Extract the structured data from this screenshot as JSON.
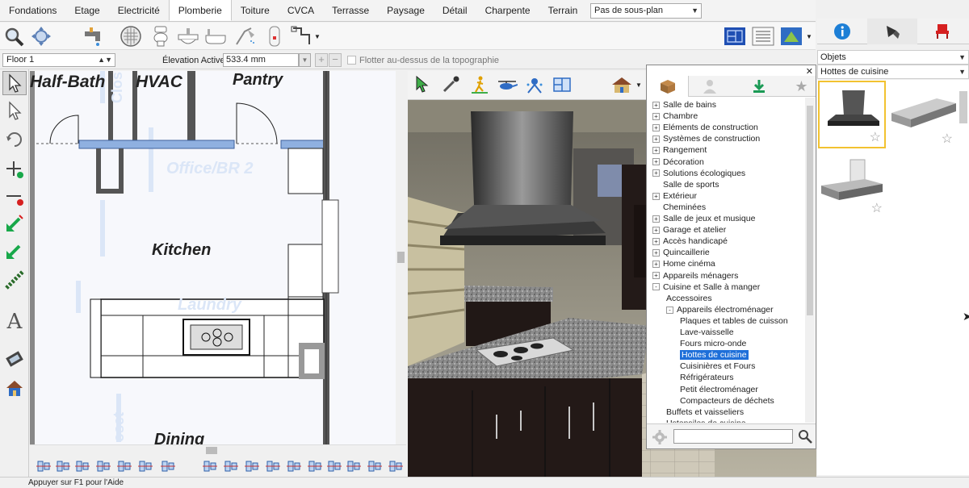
{
  "tabs": [
    "Fondations",
    "Etage",
    "Electricité",
    "Plomberie",
    "Toiture",
    "CVCA",
    "Terrasse",
    "Paysage",
    "Détail",
    "Charpente",
    "Terrain"
  ],
  "active_tab": "Plomberie",
  "plan_selector": {
    "value": "Pas de sous-plan"
  },
  "row2": {
    "floor": "Floor 1",
    "elevation_label": "Élevation Active:",
    "elevation_value": "533.4 mm",
    "float_label": "Flotter au-dessus de la topographie"
  },
  "plan": {
    "rooms": [
      "Half-Bath",
      "HVAC",
      "Pantry",
      "Kitchen",
      "Office/BR 2",
      "Laundry",
      "Dining"
    ],
    "faint_closet_top": "Clos",
    "faint_closet_bottom": "oset"
  },
  "library": {
    "tree": [
      {
        "label": "Salle de bains",
        "level": 0,
        "expander": "+"
      },
      {
        "label": "Chambre",
        "level": 0,
        "expander": "+"
      },
      {
        "label": "Eléments de construction",
        "level": 0,
        "expander": "+"
      },
      {
        "label": "Systèmes de construction",
        "level": 0,
        "expander": "+"
      },
      {
        "label": "Rangement",
        "level": 0,
        "expander": "+"
      },
      {
        "label": "Décoration",
        "level": 0,
        "expander": "+"
      },
      {
        "label": "Solutions écologiques",
        "level": 0,
        "expander": "+"
      },
      {
        "label": "Salle de sports",
        "level": 0,
        "expander": ""
      },
      {
        "label": "Extérieur",
        "level": 0,
        "expander": "+"
      },
      {
        "label": "Cheminées",
        "level": 0,
        "expander": ""
      },
      {
        "label": "Salle de jeux et musique",
        "level": 0,
        "expander": "+"
      },
      {
        "label": "Garage et atelier",
        "level": 0,
        "expander": "+"
      },
      {
        "label": "Accès handicapé",
        "level": 0,
        "expander": "+"
      },
      {
        "label": "Quincaillerie",
        "level": 0,
        "expander": "+"
      },
      {
        "label": "Home cinéma",
        "level": 0,
        "expander": "+"
      },
      {
        "label": "Appareils ménagers",
        "level": 0,
        "expander": "+"
      },
      {
        "label": "Cuisine et Salle à manger",
        "level": 0,
        "expander": "-"
      },
      {
        "label": "Accessoires",
        "level": 1,
        "expander": ""
      },
      {
        "label": "Appareils électroménager",
        "level": 1,
        "expander": "-"
      },
      {
        "label": "Plaques et tables de cuisson",
        "level": 2,
        "expander": ""
      },
      {
        "label": "Lave-vaisselle",
        "level": 2,
        "expander": ""
      },
      {
        "label": "Fours micro-onde",
        "level": 2,
        "expander": ""
      },
      {
        "label": "Hottes de cuisine",
        "level": 2,
        "expander": "",
        "selected": true
      },
      {
        "label": "Cuisinières et Fours",
        "level": 2,
        "expander": ""
      },
      {
        "label": "Réfrigérateurs",
        "level": 2,
        "expander": ""
      },
      {
        "label": "Petit électroménager",
        "level": 2,
        "expander": ""
      },
      {
        "label": "Compacteurs de déchets",
        "level": 2,
        "expander": ""
      },
      {
        "label": "Buffets et vaisseliers",
        "level": 1,
        "expander": ""
      },
      {
        "label": "Ustensiles de cuisine",
        "level": 1,
        "expander": ""
      }
    ],
    "close_glyph": "✕"
  },
  "right_panel": {
    "objects_select": "Objets",
    "category_select": "Hottes de cuisine"
  },
  "status": "Appuyer sur F1 pour l'Aide",
  "colors": {
    "accent": "#1e6fd9",
    "wall": "#7f9ed6",
    "selected_thumb": "#f2c230"
  }
}
